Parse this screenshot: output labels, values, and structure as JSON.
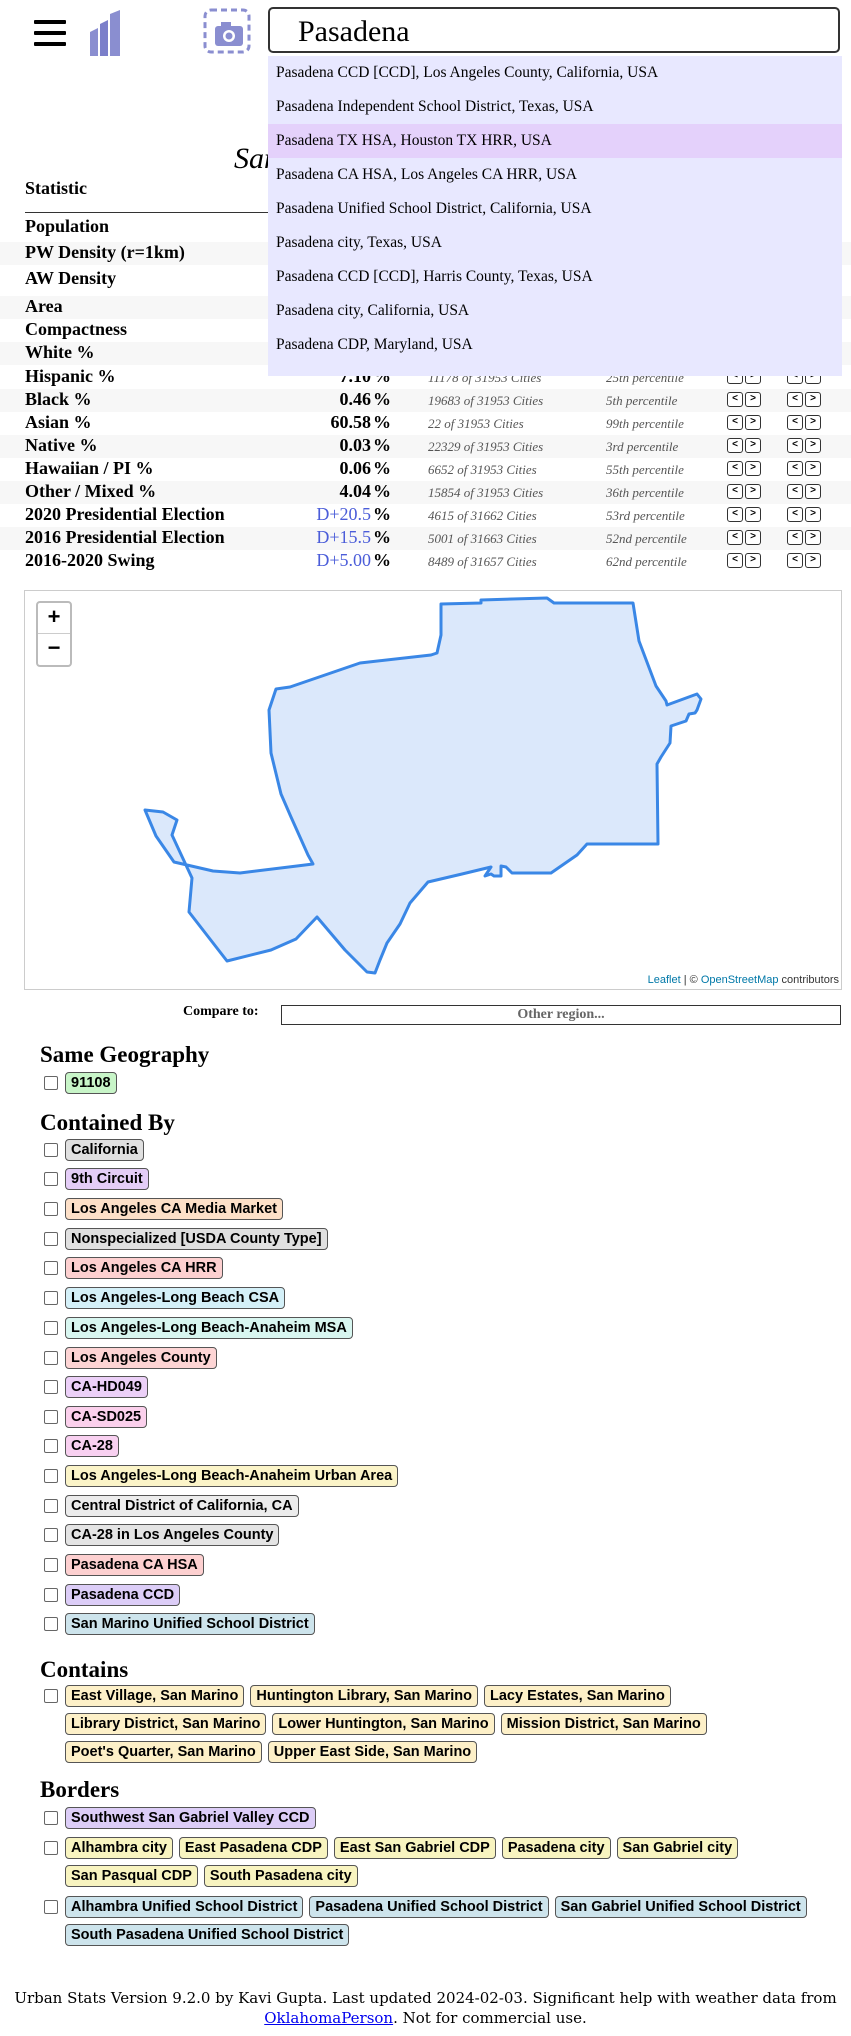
{
  "search": {
    "value": "Pasadena"
  },
  "dropdown": [
    "Pasadena CCD [CCD], Los Angeles County, California, USA",
    "Pasadena Independent School District, Texas, USA",
    "Pasadena TX HSA, Houston TX HRR, USA",
    "Pasadena CA HSA, Los Angeles CA HRR, USA",
    "Pasadena Unified School District, California, USA",
    "Pasadena city, Texas, USA",
    "Pasadena CCD [CCD], Harris County, Texas, USA",
    "Pasadena city, California, USA",
    "Pasadena CDP, Maryland, USA"
  ],
  "page_title": "San",
  "stat_header": "Statistic",
  "rows": [
    {
      "name": "Population",
      "value": "",
      "unit": "",
      "rank": "",
      "percentile": ""
    },
    {
      "name": "PW Density (r=1km)",
      "value": "",
      "unit": "",
      "rank": "",
      "percentile": ""
    },
    {
      "name": "AW Density",
      "value": "",
      "unit": "",
      "rank": "",
      "percentile": ""
    },
    {
      "name": "Area",
      "value": "",
      "unit": "",
      "rank": "",
      "percentile": ""
    },
    {
      "name": "Compactness",
      "value": "",
      "unit": "",
      "rank": "",
      "percentile": ""
    },
    {
      "name": "White %",
      "value": "",
      "unit": "",
      "rank": "",
      "percentile": ""
    },
    {
      "name": "Hispanic %",
      "value": "7.10",
      "unit": "%",
      "rank": "11178 of 31953 Cities",
      "percentile": "25th percentile"
    },
    {
      "name": "Black %",
      "value": "0.46",
      "unit": "%",
      "rank": "19683 of 31953 Cities",
      "percentile": "5th percentile"
    },
    {
      "name": "Asian %",
      "value": "60.58",
      "unit": "%",
      "rank": "22 of 31953 Cities",
      "percentile": "99th percentile"
    },
    {
      "name": "Native %",
      "value": "0.03",
      "unit": "%",
      "rank": "22329 of 31953 Cities",
      "percentile": "3rd percentile"
    },
    {
      "name": "Hawaiian / PI %",
      "value": "0.06",
      "unit": "%",
      "rank": "6652 of 31953 Cities",
      "percentile": "55th percentile"
    },
    {
      "name": "Other / Mixed %",
      "value": "4.04",
      "unit": "%",
      "rank": "15854 of 31953 Cities",
      "percentile": "36th percentile"
    },
    {
      "name": "2020 Presidential Election",
      "value": "D+20.5",
      "unit": "%",
      "rank": "4615 of 31662 Cities",
      "percentile": "53rd percentile",
      "blue": true
    },
    {
      "name": "2016 Presidential Election",
      "value": "D+15.5",
      "unit": "%",
      "rank": "5001 of 31663 Cities",
      "percentile": "52nd percentile",
      "blue": true
    },
    {
      "name": "2016-2020 Swing",
      "value": "D+5.00",
      "unit": "%",
      "rank": "8489 of 31657 Cities",
      "percentile": "62nd percentile",
      "blue": true
    }
  ],
  "nav": {
    "prev": "<",
    "next": ">"
  },
  "map": {
    "zoom_in": "+",
    "zoom_out": "−",
    "attribution_leaflet": "Leaflet",
    "attribution_sep": " | © ",
    "attribution_osm": "OpenStreetMap",
    "attribution_tail": " contributors"
  },
  "compare": {
    "label": "Compare to:",
    "placeholder": "Other region..."
  },
  "sections": {
    "same_geography": {
      "title": "Same Geography",
      "rows": [
        [
          {
            "label": "91108",
            "color": "#c8f5c8"
          }
        ]
      ]
    },
    "contained_by": {
      "title": "Contained By",
      "rows": [
        [
          {
            "label": "California",
            "color": "#e0e0e0"
          }
        ],
        [
          {
            "label": "9th Circuit",
            "color": "#e4cdf7"
          }
        ],
        [
          {
            "label": "Los Angeles CA Media Market",
            "color": "#fde0c8"
          }
        ],
        [
          {
            "label": "Nonspecialized [USDA County Type]",
            "color": "#e0e0e0"
          }
        ],
        [
          {
            "label": "Los Angeles CA HRR",
            "color": "#fdd0d0"
          }
        ],
        [
          {
            "label": "Los Angeles-Long Beach CSA",
            "color": "#d4f0f8"
          }
        ],
        [
          {
            "label": "Los Angeles-Long Beach-Anaheim MSA",
            "color": "#d8f6f0"
          }
        ],
        [
          {
            "label": "Los Angeles County",
            "color": "#fdd4d4"
          }
        ],
        [
          {
            "label": "CA-HD049",
            "color": "#ecd0f8"
          }
        ],
        [
          {
            "label": "CA-SD025",
            "color": "#fbd0ec"
          }
        ],
        [
          {
            "label": "CA-28",
            "color": "#f8d0f0"
          }
        ],
        [
          {
            "label": "Los Angeles-Long Beach-Anaheim Urban Area",
            "color": "#fbf4c8"
          }
        ],
        [
          {
            "label": "Central District of California, CA",
            "color": "#ececec"
          }
        ],
        [
          {
            "label": "CA-28 in Los Angeles County",
            "color": "#e4e4e4"
          }
        ],
        [
          {
            "label": "Pasadena CA HSA",
            "color": "#fdd0d0"
          }
        ],
        [
          {
            "label": "Pasadena CCD",
            "color": "#dccdf7"
          }
        ],
        [
          {
            "label": "San Marino Unified School District",
            "color": "#cde4ec"
          }
        ]
      ]
    },
    "contains": {
      "title": "Contains",
      "rows": [
        [
          {
            "label": "East Village, San Marino",
            "color": "#fdf0c8"
          },
          {
            "label": "Huntington Library, San Marino",
            "color": "#fdf0c8"
          },
          {
            "label": "Lacy Estates, San Marino",
            "color": "#fdf0c8"
          },
          {
            "label": "Library District, San Marino",
            "color": "#fdf0c8"
          },
          {
            "label": "Lower Huntington, San Marino",
            "color": "#fdf0c8"
          },
          {
            "label": "Mission District, San Marino",
            "color": "#fdf0c8"
          },
          {
            "label": "Poet's Quarter, San Marino",
            "color": "#fdf0c8"
          },
          {
            "label": "Upper East Side, San Marino",
            "color": "#fdf0c8"
          }
        ]
      ]
    },
    "borders": {
      "title": "Borders",
      "rows": [
        [
          {
            "label": "Southwest San Gabriel Valley CCD",
            "color": "#dccdf7"
          }
        ],
        [
          {
            "label": "Alhambra city",
            "color": "#f8f4c0"
          },
          {
            "label": "East Pasadena CDP",
            "color": "#f8f4c0"
          },
          {
            "label": "East San Gabriel CDP",
            "color": "#f8f4c0"
          },
          {
            "label": "Pasadena city",
            "color": "#f8f4c0"
          },
          {
            "label": "San Gabriel city",
            "color": "#f8f4c0"
          },
          {
            "label": "San Pasqual CDP",
            "color": "#f8f4c0"
          },
          {
            "label": "South Pasadena city",
            "color": "#f8f4c0"
          }
        ],
        [
          {
            "label": "Alhambra Unified School District",
            "color": "#cde4ec"
          },
          {
            "label": "Pasadena Unified School District",
            "color": "#cde4ec"
          },
          {
            "label": "San Gabriel Unified School District",
            "color": "#cde4ec"
          },
          {
            "label": "South Pasadena Unified School District",
            "color": "#cde4ec"
          }
        ]
      ]
    }
  },
  "footer": {
    "text_before": "Urban Stats Version 9.2.0 by Kavi Gupta. Last updated 2024-02-03. Significant help with weather data from ",
    "link": "OklahomaPerson",
    "text_after": ". Not for commercial use."
  }
}
